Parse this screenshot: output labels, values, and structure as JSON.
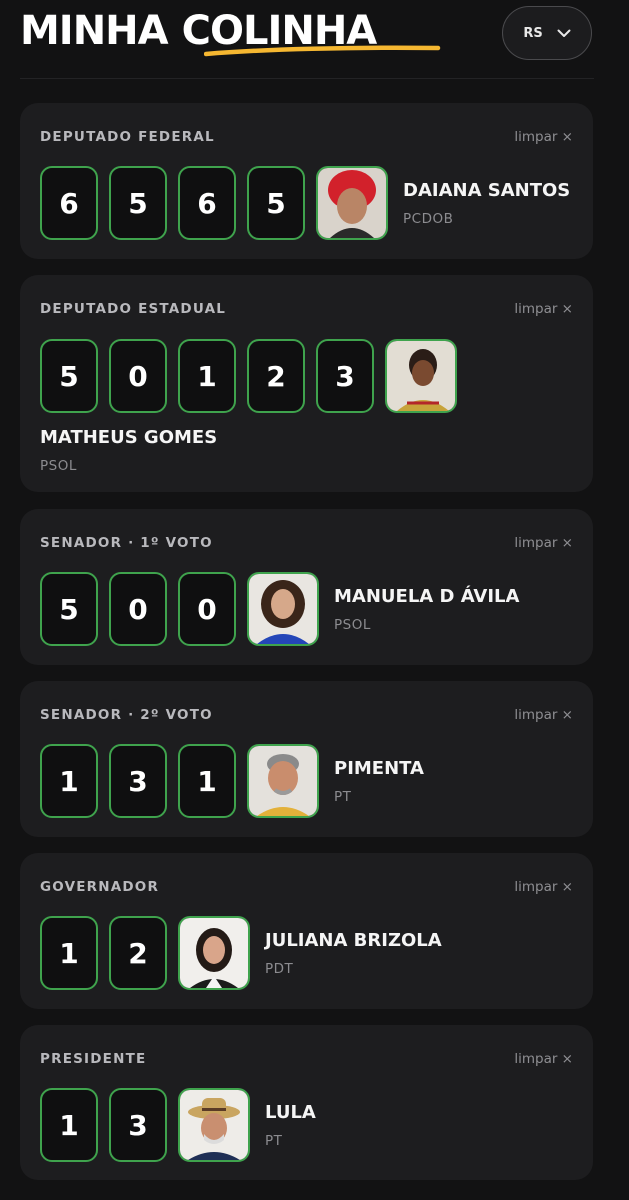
{
  "header": {
    "title_word1": "MINHA",
    "title_word2": "COLINHA",
    "state": "RS",
    "accent_underline": "#f5b731"
  },
  "colors": {
    "background": "#121213",
    "card": "#1d1d1f",
    "digit_border": "#3fa34d"
  },
  "clear_label": "limpar ×",
  "ballots": [
    {
      "office": "DEPUTADO FEDERAL",
      "digits": [
        "6",
        "5",
        "6",
        "5"
      ],
      "candidate": "DAIANA SANTOS",
      "party": "PCDOB"
    },
    {
      "office": "DEPUTADO ESTADUAL",
      "digits": [
        "5",
        "0",
        "1",
        "2",
        "3"
      ],
      "candidate": "MATHEUS GOMES",
      "party": "PSOL"
    },
    {
      "office": "SENADOR · 1º VOTO",
      "digits": [
        "5",
        "0",
        "0"
      ],
      "candidate": "MANUELA D ÁVILA",
      "party": "PSOL"
    },
    {
      "office": "SENADOR · 2º VOTO",
      "digits": [
        "1",
        "3",
        "1"
      ],
      "candidate": "PIMENTA",
      "party": "PT"
    },
    {
      "office": "GOVERNADOR",
      "digits": [
        "1",
        "2"
      ],
      "candidate": "JULIANA BRIZOLA",
      "party": "PDT"
    },
    {
      "office": "PRESIDENTE",
      "digits": [
        "1",
        "3"
      ],
      "candidate": "LULA",
      "party": "PT"
    }
  ]
}
